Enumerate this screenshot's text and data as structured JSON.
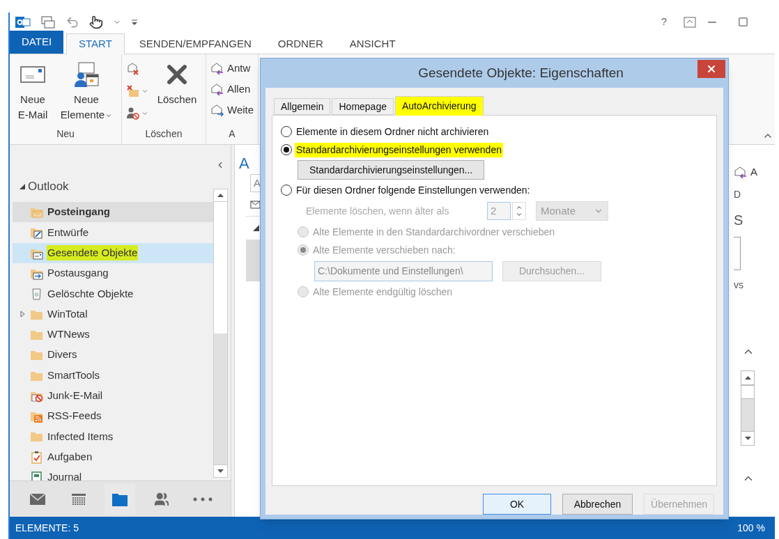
{
  "title_bar": {
    "help": "?"
  },
  "ribbon_tabs": [
    {
      "label": "DATEI",
      "kind": "file",
      "selected": false
    },
    {
      "label": "START",
      "kind": "tab",
      "selected": true
    },
    {
      "label": "SENDEN/EMPFANGEN",
      "kind": "tab",
      "selected": false
    },
    {
      "label": "ORDNER",
      "kind": "tab",
      "selected": false
    },
    {
      "label": "ANSICHT",
      "kind": "tab",
      "selected": false
    }
  ],
  "ribbon_groups": [
    {
      "label": "Neu",
      "buttons": [
        {
          "kind": "new-mail",
          "label": "Neue E-Mail",
          "dropdown": false
        },
        {
          "kind": "new-items",
          "label": "Neue Elemente",
          "dropdown": true
        }
      ]
    },
    {
      "label": "Löschen",
      "buttons": [
        {
          "kind": "ignore",
          "dropdown": false
        },
        {
          "kind": "cleanup",
          "dropdown": true
        },
        {
          "kind": "junk",
          "dropdown": true
        },
        {
          "kind": "delete",
          "label": "Löschen",
          "dropdown": false
        }
      ]
    },
    {
      "label": "A",
      "buttons": [
        {
          "kind": "reply",
          "label": "Antw",
          "dropdown": false
        },
        {
          "kind": "reply-all",
          "label": "Allen",
          "dropdown": false
        },
        {
          "kind": "forward",
          "label": "Weite",
          "dropdown": false
        }
      ]
    }
  ],
  "navigation": {
    "root": {
      "label": "Outlook",
      "expanded": true
    },
    "folders": [
      {
        "label": "Posteingang",
        "kind": "inbox",
        "bold": true,
        "hovered": true,
        "selected": false,
        "highlighted": false,
        "expandable": false
      },
      {
        "label": "Entwürfe",
        "kind": "drafts",
        "bold": false,
        "hovered": false,
        "selected": false,
        "highlighted": false,
        "expandable": false
      },
      {
        "label": "Gesendete Objekte",
        "kind": "sent",
        "bold": false,
        "hovered": false,
        "selected": true,
        "highlighted": true,
        "expandable": false
      },
      {
        "label": "Postausgang",
        "kind": "outbox",
        "bold": false,
        "hovered": false,
        "selected": false,
        "highlighted": false,
        "expandable": false
      },
      {
        "label": "Gelöschte Objekte",
        "kind": "trash",
        "bold": false,
        "hovered": false,
        "selected": false,
        "highlighted": false,
        "expandable": false
      },
      {
        "label": "WinTotal",
        "kind": "folder",
        "bold": false,
        "hovered": false,
        "selected": false,
        "highlighted": false,
        "expandable": true
      },
      {
        "label": "WTNews",
        "kind": "folder",
        "bold": false,
        "hovered": false,
        "selected": false,
        "highlighted": false,
        "expandable": false
      },
      {
        "label": "Divers",
        "kind": "folder",
        "bold": false,
        "hovered": false,
        "selected": false,
        "highlighted": false,
        "expandable": false
      },
      {
        "label": "SmartTools",
        "kind": "folder",
        "bold": false,
        "hovered": false,
        "selected": false,
        "highlighted": false,
        "expandable": false
      },
      {
        "label": "Junk-E-Mail",
        "kind": "junk",
        "bold": false,
        "hovered": false,
        "selected": false,
        "highlighted": false,
        "expandable": false
      },
      {
        "label": "RSS-Feeds",
        "kind": "rss",
        "bold": false,
        "hovered": false,
        "selected": false,
        "highlighted": false,
        "expandable": false
      },
      {
        "label": "Infected Items",
        "kind": "folder",
        "bold": false,
        "hovered": false,
        "selected": false,
        "highlighted": false,
        "expandable": false
      },
      {
        "label": "Aufgaben",
        "kind": "tasks",
        "bold": false,
        "hovered": false,
        "selected": false,
        "highlighted": false,
        "expandable": false
      },
      {
        "label": "Journal",
        "kind": "journal",
        "bold": false,
        "hovered": false,
        "selected": false,
        "highlighted": false,
        "expandable": false
      }
    ]
  },
  "nav_modules": [
    {
      "kind": "mail",
      "selected": false
    },
    {
      "kind": "calendar",
      "selected": false
    },
    {
      "kind": "folders",
      "selected": true
    },
    {
      "kind": "people",
      "selected": false
    },
    {
      "kind": "more",
      "selected": false
    }
  ],
  "middle_pane": {
    "header": "A",
    "search": {
      "placeholder": "A"
    }
  },
  "reading_pane": {
    "items": [
      {
        "kind": "action",
        "text": "A"
      },
      {
        "kind": "text",
        "text": "D"
      },
      {
        "kind": "heading",
        "text": "S"
      },
      {
        "kind": "spinner"
      },
      {
        "kind": "text",
        "text": "vs"
      }
    ]
  },
  "status_bar": {
    "count": "ELEMENTE: 5",
    "zoom": "100 %"
  },
  "dialog": {
    "title": "Gesendete Objekte: Eigenschaften",
    "tabs": [
      {
        "label": "Allgemein",
        "selected": false,
        "highlighted": false
      },
      {
        "label": "Homepage",
        "selected": false,
        "highlighted": false
      },
      {
        "label": "AutoArchivierung",
        "selected": true,
        "highlighted": true
      }
    ],
    "options": [
      {
        "kind": "radio",
        "label": "Elemente in diesem Ordner nicht archivieren",
        "selected": false,
        "disabled": false,
        "highlighted": false
      },
      {
        "kind": "radio",
        "label": "Standardarchivierungseinstellungen verwenden",
        "selected": true,
        "disabled": false,
        "highlighted": true
      },
      {
        "kind": "button",
        "label": "Standardarchivierungseinstellungen...",
        "disabled": false
      },
      {
        "kind": "radio",
        "label": "Für diesen Ordner folgende Einstellungen verwenden:",
        "selected": false,
        "disabled": false,
        "highlighted": false,
        "children": [
          {
            "kind": "age",
            "label": "Elemente löschen, wenn älter als",
            "value": "2",
            "unit": "Monate",
            "disabled": true
          },
          {
            "kind": "radio",
            "label": "Alte Elemente in den Standardarchivordner verschieben",
            "selected": false,
            "disabled": true,
            "highlighted": false
          },
          {
            "kind": "radio",
            "label": "Alte Elemente verschieben nach:",
            "selected": true,
            "disabled": true,
            "highlighted": false
          },
          {
            "kind": "path",
            "value": "C:\\Dokumente und Einstellungen\\",
            "button": "Durchsuchen...",
            "disabled": true
          },
          {
            "kind": "radio",
            "label": "Alte Elemente endgültig löschen",
            "selected": false,
            "disabled": true,
            "highlighted": false
          }
        ]
      }
    ],
    "buttons": [
      {
        "label": "OK",
        "default": true,
        "disabled": false
      },
      {
        "label": "Abbrechen",
        "default": false,
        "disabled": false
      },
      {
        "label": "Übernehmen",
        "default": false,
        "disabled": true
      }
    ]
  }
}
